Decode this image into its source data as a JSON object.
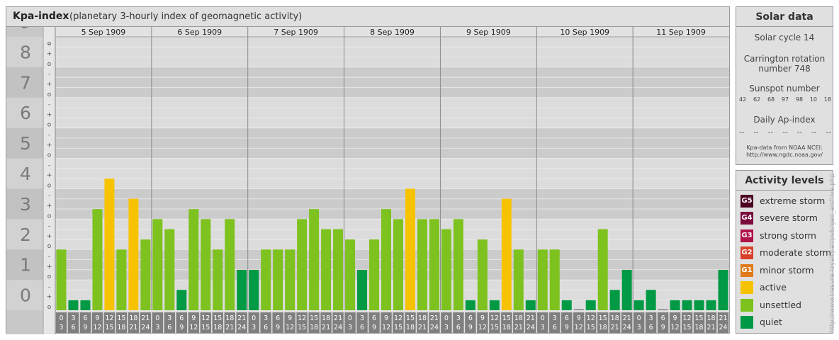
{
  "header": {
    "title": "Kpa-index",
    "subtitle": "(planetary 3-hourly index of geomagnetic activity)"
  },
  "chart_data": {
    "type": "bar",
    "title": "Kpa-index",
    "subtitle": "(planetary 3-hourly index of geomagnetic activity)",
    "ylim": [
      0,
      9
    ],
    "y_ticks": [
      "0",
      "1",
      "2",
      "3",
      "4",
      "5",
      "6",
      "7",
      "8",
      "9"
    ],
    "y_subticks": [
      "o",
      "+",
      "-"
    ],
    "dates": [
      "5 Sep 1909",
      "6 Sep 1909",
      "7 Sep 1909",
      "8 Sep 1909",
      "9 Sep 1909",
      "10 Sep 1909",
      "11 Sep 1909"
    ],
    "interval_labels": [
      [
        "0",
        "3"
      ],
      [
        "3",
        "6"
      ],
      [
        "6",
        "9"
      ],
      [
        "9",
        "12"
      ],
      [
        "12",
        "15"
      ],
      [
        "15",
        "18"
      ],
      [
        "18",
        "21"
      ],
      [
        "21",
        "24"
      ]
    ],
    "values": [
      [
        2.0,
        0.33,
        0.33,
        3.33,
        4.33,
        2.0,
        3.67,
        2.33
      ],
      [
        3.0,
        2.67,
        0.67,
        3.33,
        3.0,
        2.0,
        3.0,
        1.33
      ],
      [
        1.33,
        2.0,
        2.0,
        2.0,
        3.0,
        3.33,
        2.67,
        2.67
      ],
      [
        2.33,
        1.33,
        2.33,
        3.33,
        3.0,
        4.0,
        3.0,
        3.0
      ],
      [
        2.67,
        3.0,
        0.33,
        2.33,
        0.33,
        3.67,
        2.0,
        0.33
      ],
      [
        1.33,
        2.0,
        2.0,
        0.33,
        0.0,
        0.33,
        2.67,
        0.67
      ],
      [
        1.33,
        0.33,
        0.67,
        0.0,
        0.33,
        0.33,
        0.33,
        0.33
      ]
    ],
    "categories_order": "per day, 8 three-hour intervals"
  },
  "fix_last_day": [
    0.33,
    0.67,
    0.0,
    0.33,
    0.33,
    0.33,
    0.33,
    1.33
  ],
  "fix_day6": [
    2.0,
    2.0,
    0.33,
    0.0,
    0.33,
    2.67,
    0.67,
    1.33
  ],
  "colors": {
    "quiet": "#009944",
    "unsettled": "#7dc21e",
    "active": "#f7c300",
    "g1": "#e07a1a",
    "g2": "#d9402a",
    "g3": "#b0124a",
    "g4": "#7a0a3c",
    "g5": "#4a0020"
  },
  "solar": {
    "title": "Solar data",
    "cycle": "Solar cycle 14",
    "carrington_1": "Carrington rotation",
    "carrington_2": "number 748",
    "sunspot_title": "Sunspot number",
    "sunspots": [
      "42",
      "62",
      "68",
      "97",
      "98",
      "10",
      "18"
    ],
    "ap_title": "Daily Ap-index",
    "ap_values": [
      "--",
      "--",
      "--",
      "--",
      "--",
      "--",
      "--"
    ],
    "source_1": "Kpa-data from NOAA NCEI:",
    "source_2": "http://www.ngdc.noaa.gov/"
  },
  "activity": {
    "title": "Activity levels",
    "levels": [
      {
        "code": "G5",
        "label": "extreme storm",
        "color": "#4a0020"
      },
      {
        "code": "G4",
        "label": "severe storm",
        "color": "#7a0a3c"
      },
      {
        "code": "G3",
        "label": "strong storm",
        "color": "#b0124a"
      },
      {
        "code": "G2",
        "label": "moderate storm",
        "color": "#d9402a"
      },
      {
        "code": "G1",
        "label": "minor storm",
        "color": "#e07a1a"
      },
      {
        "code": "",
        "label": "active",
        "color": "#f7c300"
      },
      {
        "code": "",
        "label": "unsettled",
        "color": "#7dc21e"
      },
      {
        "code": "",
        "label": "quiet",
        "color": "#009944"
      }
    ]
  },
  "credit": "http://www.tresure-loyalty.at/pub/geo_archive.php"
}
